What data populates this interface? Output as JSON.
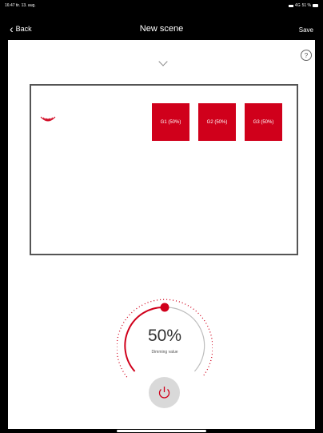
{
  "status_bar": {
    "time": "16:47",
    "date": "tir. 13. aug.",
    "network": "4G",
    "battery": "51 %"
  },
  "nav": {
    "back_label": "Back",
    "title": "New scene",
    "save_label": "Save"
  },
  "help_label": "?",
  "groups": [
    {
      "label": "G1 (50%)"
    },
    {
      "label": "G2 (50%)"
    },
    {
      "label": "G3 (50%)"
    }
  ],
  "dimmer": {
    "value_text": "50%",
    "label": "Dimming value",
    "level_percent": 50
  },
  "icons": {
    "back": "chevron-left-icon",
    "collapse": "chevron-down-icon",
    "help": "question-circle-icon",
    "sensor": "wireless-sensor-icon",
    "power": "power-icon"
  },
  "colors": {
    "accent": "#d0001b",
    "background": "#ffffff",
    "chrome": "#000000"
  }
}
